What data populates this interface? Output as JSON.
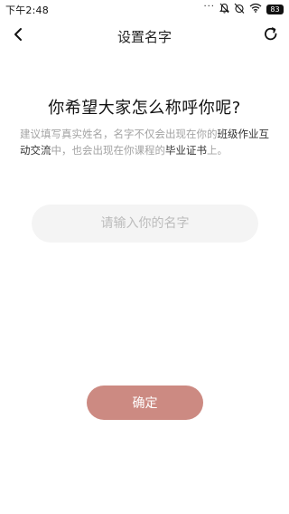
{
  "status_bar": {
    "time": "下午2:48",
    "more_dots": "···",
    "battery": "83",
    "icons": [
      "mute-icon",
      "alarm-off-icon",
      "wifi-icon",
      "battery-icon"
    ]
  },
  "nav": {
    "title": "设置名字",
    "back_icon": "chevron-left-icon",
    "refresh_icon": "refresh-icon"
  },
  "prompt": {
    "title": "你希望大家怎么称呼你呢?",
    "desc_segments": [
      {
        "text": "建议填写真实姓名，名字不仅会出现在你的",
        "highlight": false
      },
      {
        "text": "班级作业互动交流",
        "highlight": true
      },
      {
        "text": "中，也会出现在你课程的",
        "highlight": false
      },
      {
        "text": "毕业证书",
        "highlight": true
      },
      {
        "text": "上。",
        "highlight": false
      }
    ]
  },
  "name_input": {
    "value": "",
    "placeholder": "请输入你的名字"
  },
  "confirm_button": {
    "label": "确定"
  },
  "colors": {
    "accent": "#cc8a82",
    "input_bg": "#f4f4f4",
    "muted_text": "#a3a3a3",
    "highlight_text": "#333333"
  }
}
